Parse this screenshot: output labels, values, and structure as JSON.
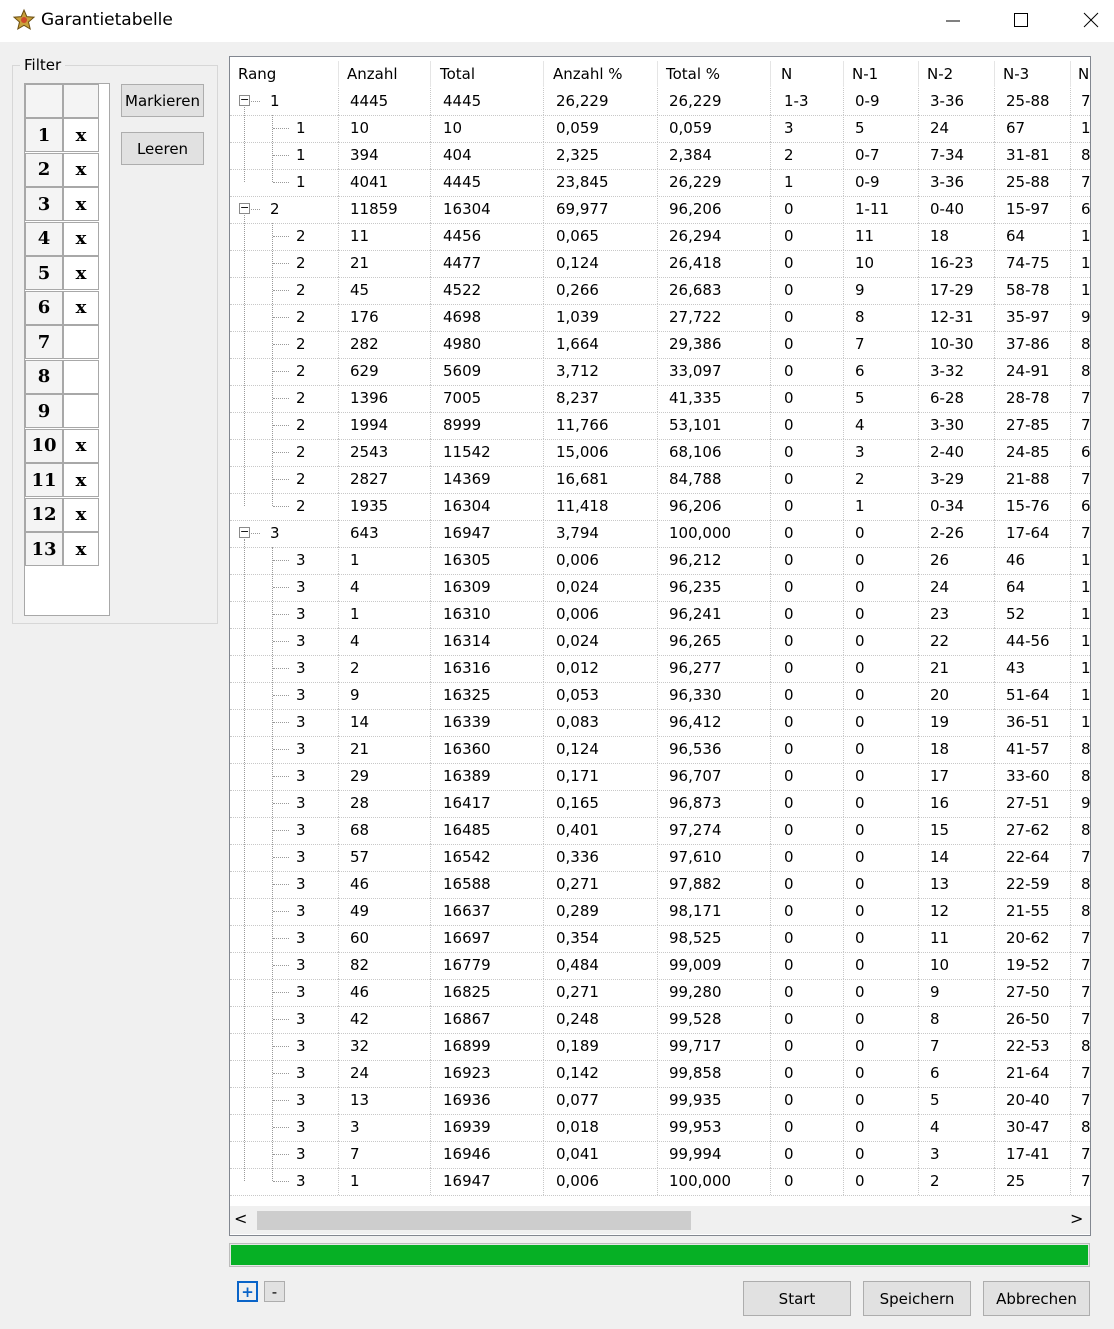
{
  "window": {
    "title": "Garantietabelle",
    "minimize": "—",
    "maximize": "☐",
    "close": "✕"
  },
  "filter": {
    "legend": "Filter",
    "rows": [
      {
        "n": "1",
        "m": "x"
      },
      {
        "n": "2",
        "m": "x"
      },
      {
        "n": "3",
        "m": "x"
      },
      {
        "n": "4",
        "m": "x"
      },
      {
        "n": "5",
        "m": "x"
      },
      {
        "n": "6",
        "m": "x"
      },
      {
        "n": "7",
        "m": ""
      },
      {
        "n": "8",
        "m": ""
      },
      {
        "n": "9",
        "m": ""
      },
      {
        "n": "10",
        "m": "x"
      },
      {
        "n": "11",
        "m": "x"
      },
      {
        "n": "12",
        "m": "x"
      },
      {
        "n": "13",
        "m": "x"
      }
    ]
  },
  "buttons": {
    "mark": "Markieren",
    "clear": "Leeren",
    "start": "Start",
    "save": "Speichern",
    "cancel": "Abbrechen",
    "expand": "+",
    "collapse": "-"
  },
  "table": {
    "columns": [
      "Rang",
      "Anzahl",
      "Total",
      "Anzahl %",
      "Total %",
      "N",
      "N-1",
      "N-2",
      "N-3",
      "N"
    ],
    "rows": [
      {
        "lvl": 0,
        "c": [
          "1",
          "4445",
          "4445",
          "26,229",
          "26,229",
          "1-3",
          "0-9",
          "3-36",
          "25-88",
          "7"
        ]
      },
      {
        "lvl": 1,
        "c": [
          "1",
          "10",
          "10",
          "0,059",
          "0,059",
          "3",
          "5",
          "24",
          "67",
          "1"
        ]
      },
      {
        "lvl": 1,
        "c": [
          "1",
          "394",
          "404",
          "2,325",
          "2,384",
          "2",
          "0-7",
          "7-34",
          "31-81",
          "8"
        ]
      },
      {
        "lvl": 1,
        "last": true,
        "c": [
          "1",
          "4041",
          "4445",
          "23,845",
          "26,229",
          "1",
          "0-9",
          "3-36",
          "25-88",
          "7"
        ]
      },
      {
        "lvl": 0,
        "c": [
          "2",
          "11859",
          "16304",
          "69,977",
          "96,206",
          "0",
          "1-11",
          "0-40",
          "15-97",
          "6"
        ]
      },
      {
        "lvl": 1,
        "c": [
          "2",
          "11",
          "4456",
          "0,065",
          "26,294",
          "0",
          "11",
          "18",
          "64",
          "1"
        ]
      },
      {
        "lvl": 1,
        "c": [
          "2",
          "21",
          "4477",
          "0,124",
          "26,418",
          "0",
          "10",
          "16-23",
          "74-75",
          "1"
        ]
      },
      {
        "lvl": 1,
        "c": [
          "2",
          "45",
          "4522",
          "0,266",
          "26,683",
          "0",
          "9",
          "17-29",
          "58-78",
          "1"
        ]
      },
      {
        "lvl": 1,
        "c": [
          "2",
          "176",
          "4698",
          "1,039",
          "27,722",
          "0",
          "8",
          "12-31",
          "35-97",
          "9"
        ]
      },
      {
        "lvl": 1,
        "c": [
          "2",
          "282",
          "4980",
          "1,664",
          "29,386",
          "0",
          "7",
          "10-30",
          "37-86",
          "8"
        ]
      },
      {
        "lvl": 1,
        "c": [
          "2",
          "629",
          "5609",
          "3,712",
          "33,097",
          "0",
          "6",
          "3-32",
          "24-91",
          "8"
        ]
      },
      {
        "lvl": 1,
        "c": [
          "2",
          "1396",
          "7005",
          "8,237",
          "41,335",
          "0",
          "5",
          "6-28",
          "28-78",
          "7"
        ]
      },
      {
        "lvl": 1,
        "c": [
          "2",
          "1994",
          "8999",
          "11,766",
          "53,101",
          "0",
          "4",
          "3-30",
          "27-85",
          "7"
        ]
      },
      {
        "lvl": 1,
        "c": [
          "2",
          "2543",
          "11542",
          "15,006",
          "68,106",
          "0",
          "3",
          "2-40",
          "24-85",
          "6"
        ]
      },
      {
        "lvl": 1,
        "c": [
          "2",
          "2827",
          "14369",
          "16,681",
          "84,788",
          "0",
          "2",
          "3-29",
          "21-88",
          "7"
        ]
      },
      {
        "lvl": 1,
        "last": true,
        "c": [
          "2",
          "1935",
          "16304",
          "11,418",
          "96,206",
          "0",
          "1",
          "0-34",
          "15-76",
          "6"
        ]
      },
      {
        "lvl": 0,
        "c": [
          "3",
          "643",
          "16947",
          "3,794",
          "100,000",
          "0",
          "0",
          "2-26",
          "17-64",
          "7"
        ]
      },
      {
        "lvl": 1,
        "c": [
          "3",
          "1",
          "16305",
          "0,006",
          "96,212",
          "0",
          "0",
          "26",
          "46",
          "1"
        ]
      },
      {
        "lvl": 1,
        "c": [
          "3",
          "4",
          "16309",
          "0,024",
          "96,235",
          "0",
          "0",
          "24",
          "64",
          "1"
        ]
      },
      {
        "lvl": 1,
        "c": [
          "3",
          "1",
          "16310",
          "0,006",
          "96,241",
          "0",
          "0",
          "23",
          "52",
          "1"
        ]
      },
      {
        "lvl": 1,
        "c": [
          "3",
          "4",
          "16314",
          "0,024",
          "96,265",
          "0",
          "0",
          "22",
          "44-56",
          "1"
        ]
      },
      {
        "lvl": 1,
        "c": [
          "3",
          "2",
          "16316",
          "0,012",
          "96,277",
          "0",
          "0",
          "21",
          "43",
          "1"
        ]
      },
      {
        "lvl": 1,
        "c": [
          "3",
          "9",
          "16325",
          "0,053",
          "96,330",
          "0",
          "0",
          "20",
          "51-64",
          "1"
        ]
      },
      {
        "lvl": 1,
        "c": [
          "3",
          "14",
          "16339",
          "0,083",
          "96,412",
          "0",
          "0",
          "19",
          "36-51",
          "1"
        ]
      },
      {
        "lvl": 1,
        "c": [
          "3",
          "21",
          "16360",
          "0,124",
          "96,536",
          "0",
          "0",
          "18",
          "41-57",
          "8"
        ]
      },
      {
        "lvl": 1,
        "c": [
          "3",
          "29",
          "16389",
          "0,171",
          "96,707",
          "0",
          "0",
          "17",
          "33-60",
          "8"
        ]
      },
      {
        "lvl": 1,
        "c": [
          "3",
          "28",
          "16417",
          "0,165",
          "96,873",
          "0",
          "0",
          "16",
          "27-51",
          "9"
        ]
      },
      {
        "lvl": 1,
        "c": [
          "3",
          "68",
          "16485",
          "0,401",
          "97,274",
          "0",
          "0",
          "15",
          "27-62",
          "8"
        ]
      },
      {
        "lvl": 1,
        "c": [
          "3",
          "57",
          "16542",
          "0,336",
          "97,610",
          "0",
          "0",
          "14",
          "22-64",
          "7"
        ]
      },
      {
        "lvl": 1,
        "c": [
          "3",
          "46",
          "16588",
          "0,271",
          "97,882",
          "0",
          "0",
          "13",
          "22-59",
          "8"
        ]
      },
      {
        "lvl": 1,
        "c": [
          "3",
          "49",
          "16637",
          "0,289",
          "98,171",
          "0",
          "0",
          "12",
          "21-55",
          "8"
        ]
      },
      {
        "lvl": 1,
        "c": [
          "3",
          "60",
          "16697",
          "0,354",
          "98,525",
          "0",
          "0",
          "11",
          "20-62",
          "7"
        ]
      },
      {
        "lvl": 1,
        "c": [
          "3",
          "82",
          "16779",
          "0,484",
          "99,009",
          "0",
          "0",
          "10",
          "19-52",
          "7"
        ]
      },
      {
        "lvl": 1,
        "c": [
          "3",
          "46",
          "16825",
          "0,271",
          "99,280",
          "0",
          "0",
          "9",
          "27-50",
          "7"
        ]
      },
      {
        "lvl": 1,
        "c": [
          "3",
          "42",
          "16867",
          "0,248",
          "99,528",
          "0",
          "0",
          "8",
          "26-50",
          "7"
        ]
      },
      {
        "lvl": 1,
        "c": [
          "3",
          "32",
          "16899",
          "0,189",
          "99,717",
          "0",
          "0",
          "7",
          "22-53",
          "8"
        ]
      },
      {
        "lvl": 1,
        "c": [
          "3",
          "24",
          "16923",
          "0,142",
          "99,858",
          "0",
          "0",
          "6",
          "21-64",
          "7"
        ]
      },
      {
        "lvl": 1,
        "c": [
          "3",
          "13",
          "16936",
          "0,077",
          "99,935",
          "0",
          "0",
          "5",
          "20-40",
          "7"
        ]
      },
      {
        "lvl": 1,
        "c": [
          "3",
          "3",
          "16939",
          "0,018",
          "99,953",
          "0",
          "0",
          "4",
          "30-47",
          "8"
        ]
      },
      {
        "lvl": 1,
        "c": [
          "3",
          "7",
          "16946",
          "0,041",
          "99,994",
          "0",
          "0",
          "3",
          "17-41",
          "7"
        ]
      },
      {
        "lvl": 1,
        "last": true,
        "c": [
          "3",
          "1",
          "16947",
          "0,006",
          "100,000",
          "0",
          "0",
          "2",
          "25",
          "7"
        ]
      }
    ]
  },
  "scroll": {
    "left": "<",
    "right": ">"
  },
  "progress": {
    "percent": 100,
    "color": "#06b025"
  }
}
